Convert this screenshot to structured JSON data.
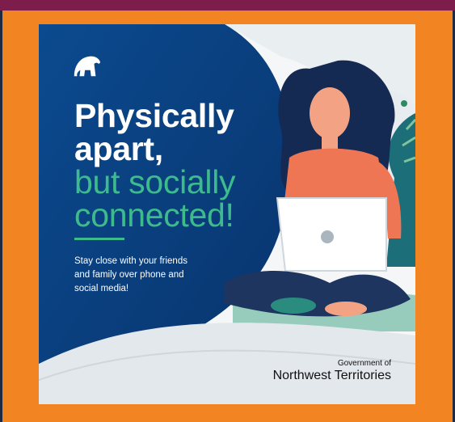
{
  "poster": {
    "headline_line1": "Physically",
    "headline_line2": "apart,",
    "headline_line3": "but socially",
    "headline_line4": "connected!",
    "body_line1": "Stay close with your friends",
    "body_line2": "and family over phone and",
    "body_line3": "social media!",
    "gov_line1": "Government of",
    "gov_line2": "Northwest Territories",
    "logo_icon": "polar-bear-icon"
  },
  "colors": {
    "frame_orange": "#f28522",
    "top_bar": "#7d1d4c",
    "navy": "#0a3f7a",
    "accent_green": "#3dbb8c"
  }
}
